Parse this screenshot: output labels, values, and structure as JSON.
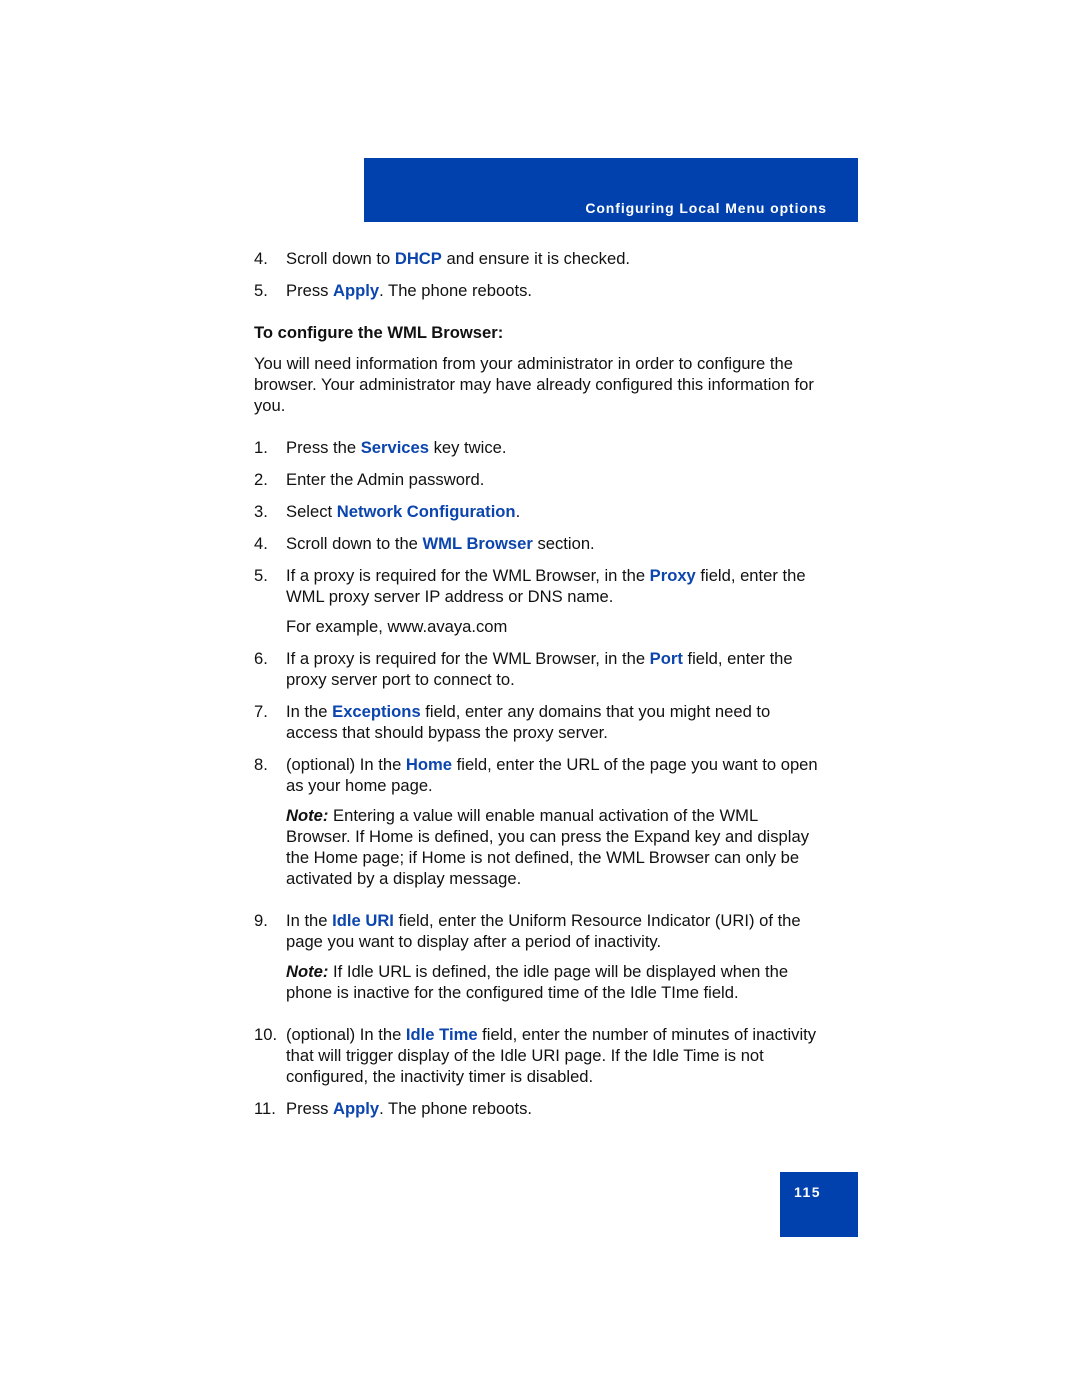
{
  "header": {
    "title": "Configuring Local Menu options"
  },
  "colors": {
    "brand_blue": "#0041ad",
    "keyword_blue": "#0b45ad"
  },
  "intro_steps": [
    {
      "num": "4.",
      "pre": "Scroll down to ",
      "kw": "DHCP",
      "post": " and ensure it is checked."
    },
    {
      "num": "5.",
      "pre": "Press ",
      "kw": "Apply",
      "post": ". The phone reboots."
    }
  ],
  "section": {
    "heading": "To configure the WML Browser:",
    "intro": "You will need information from your administrator in order to configure the browser. Your administrator may have already configured this information for you."
  },
  "steps": [
    {
      "num": "1.",
      "pre": "Press the ",
      "kw": "Services",
      "post": " key twice."
    },
    {
      "num": "2.",
      "pre": "Enter the Admin password.",
      "kw": "",
      "post": ""
    },
    {
      "num": "3.",
      "pre": "Select ",
      "kw": "Network Configuration",
      "post": "."
    },
    {
      "num": "4.",
      "pre": "Scroll down to the ",
      "kw": "WML Browser",
      "post": " section."
    },
    {
      "num": "5.",
      "pre": "If a proxy is required for the WML Browser, in the ",
      "kw": "Proxy",
      "post": " field, enter the WML proxy server IP address or DNS name.",
      "extra": "For example, www.avaya.com"
    },
    {
      "num": "6.",
      "pre": "If a proxy is required for the WML Browser, in the ",
      "kw": "Port",
      "post": " field, enter the proxy server port to connect to."
    },
    {
      "num": "7.",
      "pre": "In the ",
      "kw": "Exceptions",
      "post": " field, enter any domains that you might need to access that should bypass the proxy server."
    },
    {
      "num": "8.",
      "pre": "(optional) In the ",
      "kw": "Home",
      "post": " field, enter the URL of the page you want to open as your home page.",
      "note_label": "Note:",
      "note": " Entering a value will enable manual activation of the WML Browser. If Home is defined, you can press the Expand key and display the Home page; if Home is not defined, the WML Browser can only be activated by a display message."
    },
    {
      "num": "9.",
      "pre": "In the ",
      "kw": "Idle URI",
      "post": " field, enter the Uniform Resource Indicator (URI) of the page you want to display after a period of inactivity.",
      "note_label": "Note:",
      "note": " If Idle URL is defined, the idle page will be displayed when the phone is inactive for the configured time of the Idle TIme field."
    },
    {
      "num": "10.",
      "pre": "(optional) In the ",
      "kw": "Idle Time",
      "post": " field, enter the number of minutes of inactivity that will trigger display of the Idle URI page. If the Idle Time is not configured, the inactivity timer is disabled."
    },
    {
      "num": "11.",
      "pre": "Press ",
      "kw": "Apply",
      "post": ". The phone reboots."
    }
  ],
  "footer": {
    "page_number": "115"
  }
}
